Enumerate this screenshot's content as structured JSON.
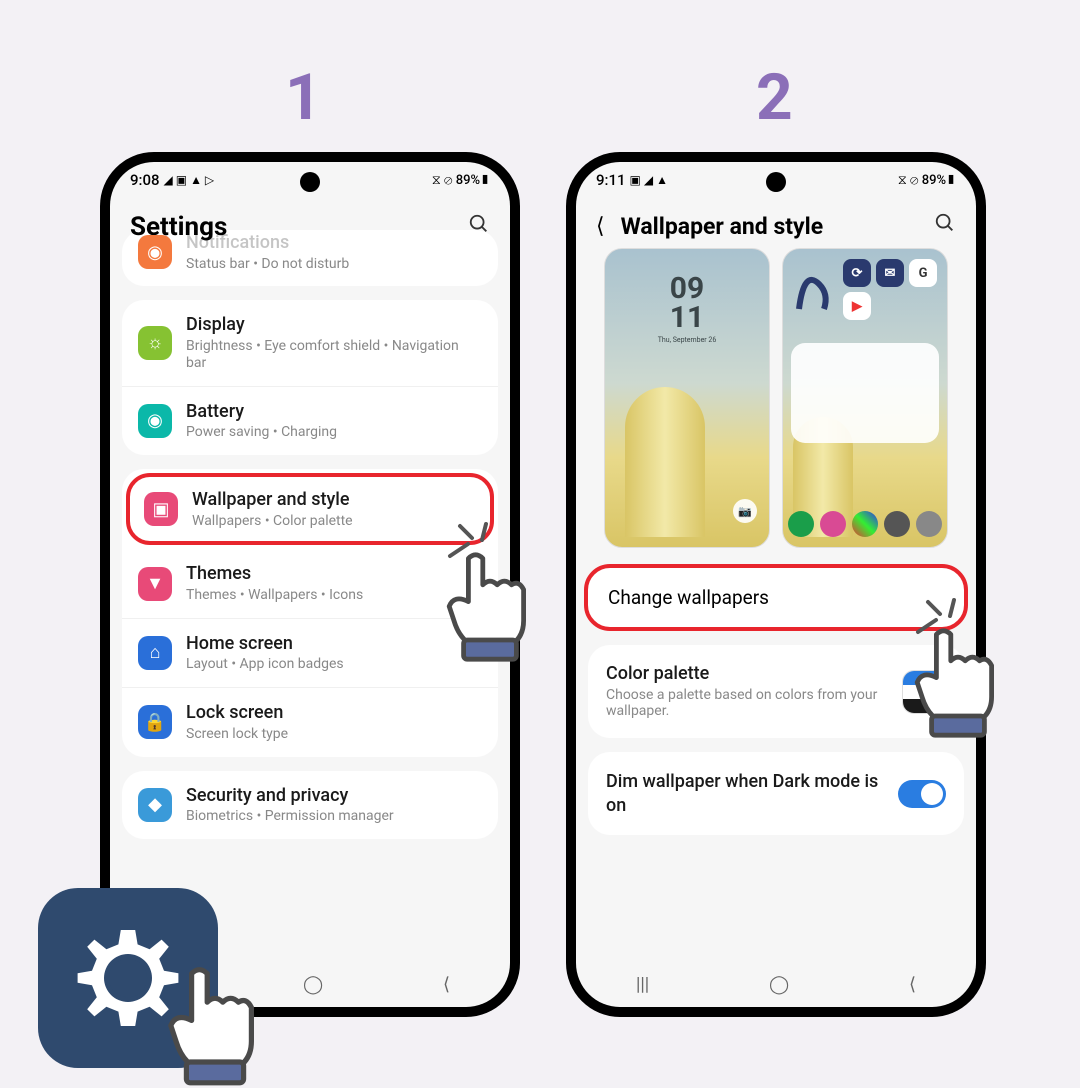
{
  "steps": {
    "one": "1",
    "two": "2"
  },
  "phone1": {
    "status": {
      "time": "9:08",
      "icons_l": "◢ ▣ ▲ ▷",
      "icons_r": "⧖ ⊘ 89%▮"
    },
    "header": "Settings",
    "rows": {
      "notif": {
        "title": "Notifications",
        "sub": "Status bar  •  Do not disturb",
        "color": "#f4793e"
      },
      "display": {
        "title": "Display",
        "sub": "Brightness  •  Eye comfort shield  •  Navigation bar",
        "color": "#86c232"
      },
      "battery": {
        "title": "Battery",
        "sub": "Power saving  •  Charging",
        "color": "#0bb8a9"
      },
      "wallpaper": {
        "title": "Wallpaper and style",
        "sub": "Wallpapers  •  Color palette",
        "color": "#e84a78"
      },
      "themes": {
        "title": "Themes",
        "sub": "Themes  •  Wallpapers  •  Icons",
        "color": "#e84a78"
      },
      "home": {
        "title": "Home screen",
        "sub": "Layout  •  App icon badges",
        "color": "#2a6fd9"
      },
      "lock": {
        "title": "Lock screen",
        "sub": "Screen lock type",
        "color": "#2a6fd9"
      },
      "security": {
        "title": "Security and privacy",
        "sub": "Biometrics  •  Permission manager",
        "color": "#3a9ad9"
      }
    }
  },
  "phone2": {
    "status": {
      "time": "9:11",
      "icons_l": "▣ ◢ ▲",
      "icons_r": "⧖ ⊘ 89%▮"
    },
    "header": "Wallpaper and style",
    "preview_clock": {
      "l1": "09",
      "l2": "11",
      "date": "Thu, September 26"
    },
    "change": "Change wallpapers",
    "palette": {
      "title": "Color palette",
      "sub": "Choose a palette based on colors from your wallpaper."
    },
    "dim": "Dim wallpaper when Dark mode is on"
  }
}
